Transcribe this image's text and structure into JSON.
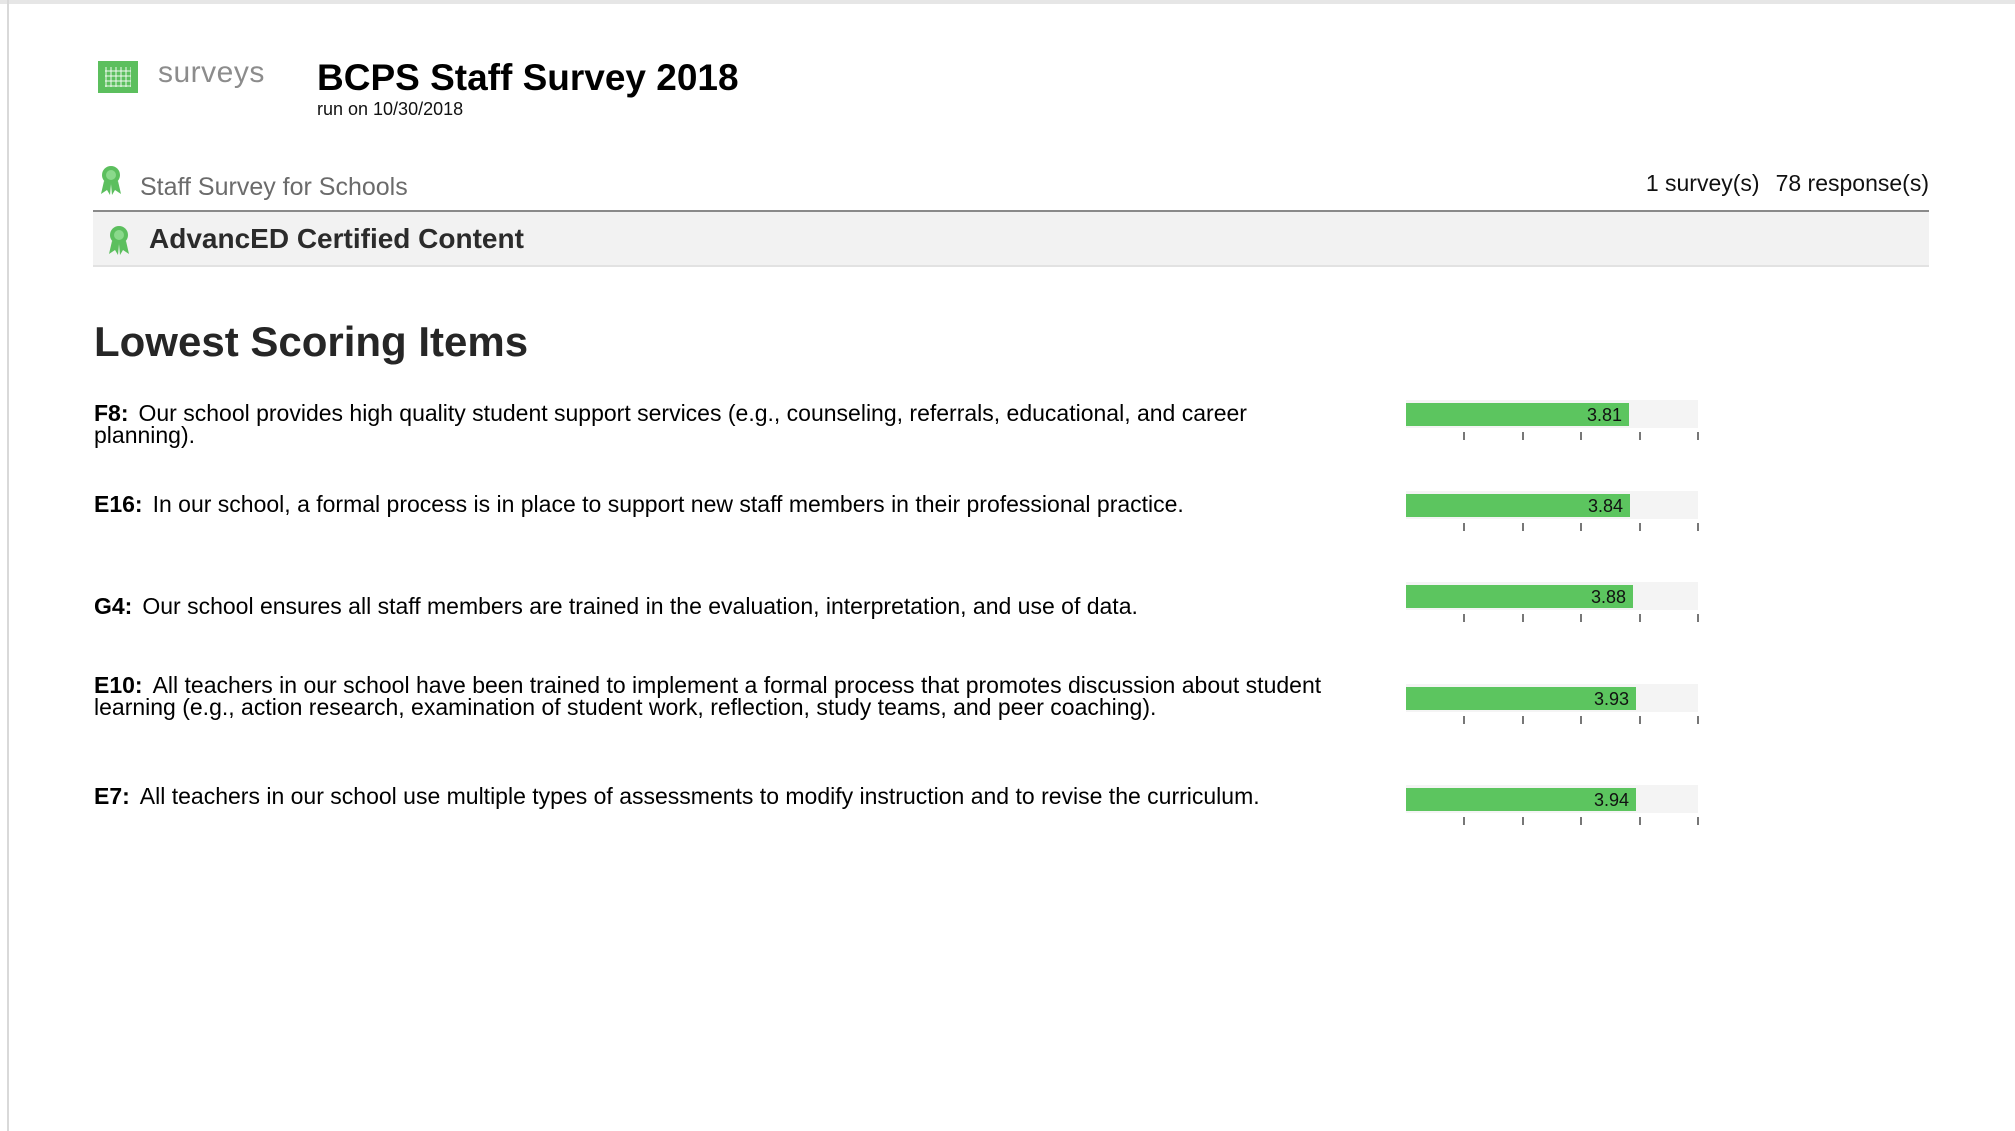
{
  "header": {
    "logo_text": "surveys",
    "title": "BCPS Staff Survey 2018",
    "run_on": "run on 10/30/2018"
  },
  "breadcrumb": {
    "label": "Staff Survey for Schools",
    "surveys": "1 survey(s)",
    "responses": "78 response(s)"
  },
  "band": {
    "label": "AdvancED Certified Content"
  },
  "section": {
    "title": "Lowest Scoring Items"
  },
  "colors": {
    "bar_fill": "#5cc55f",
    "award": "#5cbf5e"
  },
  "scale_max": 5,
  "items": [
    {
      "code": "F8:",
      "text": "Our school provides high quality student support services (e.g., counseling, referrals, educational, and career planning).",
      "score": "3.81"
    },
    {
      "code": "E16:",
      "text": "In our school, a formal process is in place to support new staff members in their professional practice.",
      "score": "3.84"
    },
    {
      "code": "G4:",
      "text": "Our school ensures all staff members are trained in the evaluation, interpretation, and use of data.",
      "score": "3.88"
    },
    {
      "code": "E10:",
      "text": "All teachers in our school have been trained to implement a formal process that promotes discussion about student learning (e.g., action research, examination of student work, reflection, study teams, and peer coaching).",
      "score": "3.93"
    },
    {
      "code": "E7:",
      "text": "All teachers in our school use multiple types of assessments to modify instruction and to revise the curriculum.",
      "score": "3.94"
    }
  ]
}
